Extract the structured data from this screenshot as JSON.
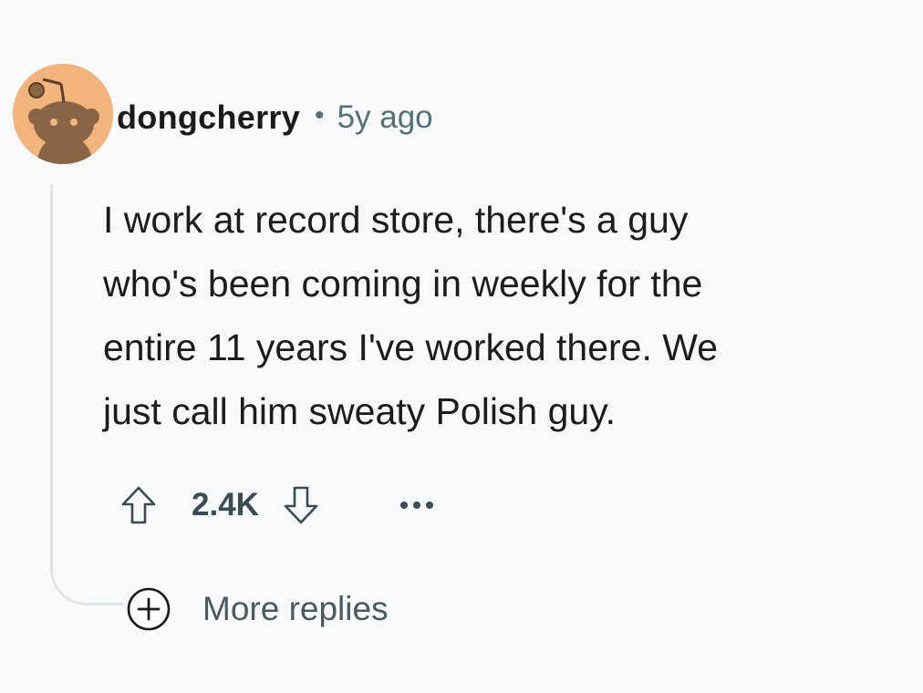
{
  "comment": {
    "author": "dongcherry",
    "separator": "•",
    "timestamp": "5y ago",
    "body_lines": [
      "I work at record store, there's a guy",
      "who's been coming in weekly for the",
      "entire 11 years I've worked there. We",
      "just call him sweaty Polish guy."
    ],
    "score": "2.4K",
    "more_replies_label": "More replies",
    "avatar_icon": "snoo-avatar-icon",
    "upvote_icon": "upvote-arrow-icon",
    "downvote_icon": "downvote-arrow-icon",
    "overflow_icon": "overflow-menu-icon",
    "expand_icon": "plus-circle-icon"
  },
  "colors": {
    "background": "#f8f9fb",
    "avatar_background": "#f1b47c",
    "username": "#1a1a1b",
    "meta": "#576f76",
    "thread_line": "#e1e4e6"
  }
}
